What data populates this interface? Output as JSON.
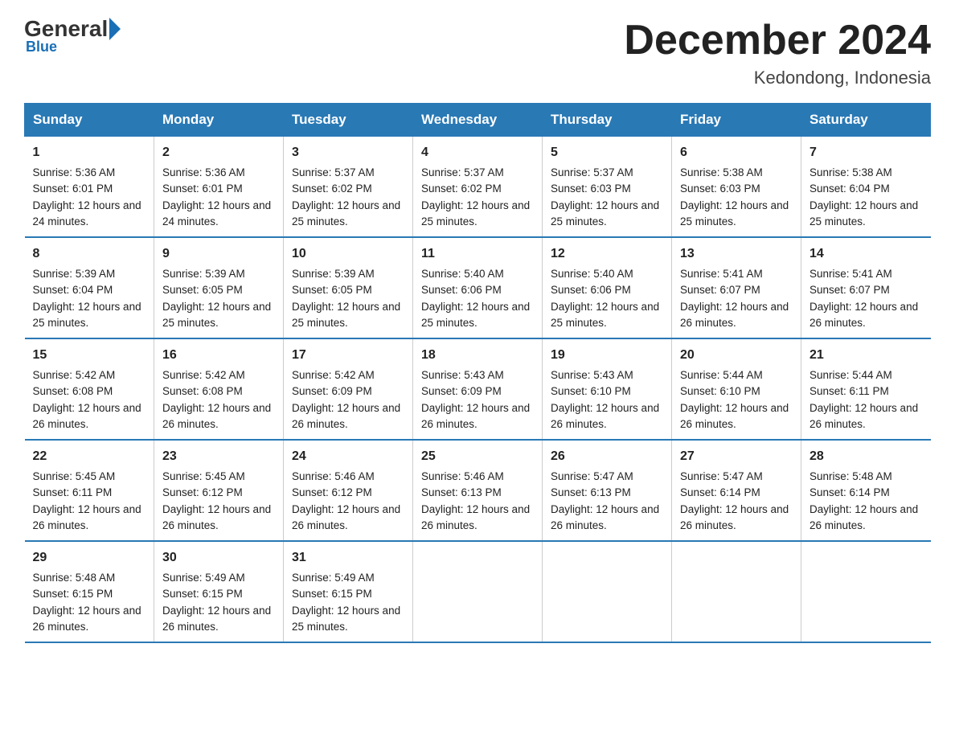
{
  "logo": {
    "general": "General",
    "blue": "Blue",
    "subtitle": "Blue"
  },
  "header": {
    "month_title": "December 2024",
    "location": "Kedondong, Indonesia"
  },
  "days_of_week": [
    "Sunday",
    "Monday",
    "Tuesday",
    "Wednesday",
    "Thursday",
    "Friday",
    "Saturday"
  ],
  "weeks": [
    [
      {
        "day": 1,
        "sunrise": "5:36 AM",
        "sunset": "6:01 PM",
        "daylight": "12 hours and 24 minutes."
      },
      {
        "day": 2,
        "sunrise": "5:36 AM",
        "sunset": "6:01 PM",
        "daylight": "12 hours and 24 minutes."
      },
      {
        "day": 3,
        "sunrise": "5:37 AM",
        "sunset": "6:02 PM",
        "daylight": "12 hours and 25 minutes."
      },
      {
        "day": 4,
        "sunrise": "5:37 AM",
        "sunset": "6:02 PM",
        "daylight": "12 hours and 25 minutes."
      },
      {
        "day": 5,
        "sunrise": "5:37 AM",
        "sunset": "6:03 PM",
        "daylight": "12 hours and 25 minutes."
      },
      {
        "day": 6,
        "sunrise": "5:38 AM",
        "sunset": "6:03 PM",
        "daylight": "12 hours and 25 minutes."
      },
      {
        "day": 7,
        "sunrise": "5:38 AM",
        "sunset": "6:04 PM",
        "daylight": "12 hours and 25 minutes."
      }
    ],
    [
      {
        "day": 8,
        "sunrise": "5:39 AM",
        "sunset": "6:04 PM",
        "daylight": "12 hours and 25 minutes."
      },
      {
        "day": 9,
        "sunrise": "5:39 AM",
        "sunset": "6:05 PM",
        "daylight": "12 hours and 25 minutes."
      },
      {
        "day": 10,
        "sunrise": "5:39 AM",
        "sunset": "6:05 PM",
        "daylight": "12 hours and 25 minutes."
      },
      {
        "day": 11,
        "sunrise": "5:40 AM",
        "sunset": "6:06 PM",
        "daylight": "12 hours and 25 minutes."
      },
      {
        "day": 12,
        "sunrise": "5:40 AM",
        "sunset": "6:06 PM",
        "daylight": "12 hours and 25 minutes."
      },
      {
        "day": 13,
        "sunrise": "5:41 AM",
        "sunset": "6:07 PM",
        "daylight": "12 hours and 26 minutes."
      },
      {
        "day": 14,
        "sunrise": "5:41 AM",
        "sunset": "6:07 PM",
        "daylight": "12 hours and 26 minutes."
      }
    ],
    [
      {
        "day": 15,
        "sunrise": "5:42 AM",
        "sunset": "6:08 PM",
        "daylight": "12 hours and 26 minutes."
      },
      {
        "day": 16,
        "sunrise": "5:42 AM",
        "sunset": "6:08 PM",
        "daylight": "12 hours and 26 minutes."
      },
      {
        "day": 17,
        "sunrise": "5:42 AM",
        "sunset": "6:09 PM",
        "daylight": "12 hours and 26 minutes."
      },
      {
        "day": 18,
        "sunrise": "5:43 AM",
        "sunset": "6:09 PM",
        "daylight": "12 hours and 26 minutes."
      },
      {
        "day": 19,
        "sunrise": "5:43 AM",
        "sunset": "6:10 PM",
        "daylight": "12 hours and 26 minutes."
      },
      {
        "day": 20,
        "sunrise": "5:44 AM",
        "sunset": "6:10 PM",
        "daylight": "12 hours and 26 minutes."
      },
      {
        "day": 21,
        "sunrise": "5:44 AM",
        "sunset": "6:11 PM",
        "daylight": "12 hours and 26 minutes."
      }
    ],
    [
      {
        "day": 22,
        "sunrise": "5:45 AM",
        "sunset": "6:11 PM",
        "daylight": "12 hours and 26 minutes."
      },
      {
        "day": 23,
        "sunrise": "5:45 AM",
        "sunset": "6:12 PM",
        "daylight": "12 hours and 26 minutes."
      },
      {
        "day": 24,
        "sunrise": "5:46 AM",
        "sunset": "6:12 PM",
        "daylight": "12 hours and 26 minutes."
      },
      {
        "day": 25,
        "sunrise": "5:46 AM",
        "sunset": "6:13 PM",
        "daylight": "12 hours and 26 minutes."
      },
      {
        "day": 26,
        "sunrise": "5:47 AM",
        "sunset": "6:13 PM",
        "daylight": "12 hours and 26 minutes."
      },
      {
        "day": 27,
        "sunrise": "5:47 AM",
        "sunset": "6:14 PM",
        "daylight": "12 hours and 26 minutes."
      },
      {
        "day": 28,
        "sunrise": "5:48 AM",
        "sunset": "6:14 PM",
        "daylight": "12 hours and 26 minutes."
      }
    ],
    [
      {
        "day": 29,
        "sunrise": "5:48 AM",
        "sunset": "6:15 PM",
        "daylight": "12 hours and 26 minutes."
      },
      {
        "day": 30,
        "sunrise": "5:49 AM",
        "sunset": "6:15 PM",
        "daylight": "12 hours and 26 minutes."
      },
      {
        "day": 31,
        "sunrise": "5:49 AM",
        "sunset": "6:15 PM",
        "daylight": "12 hours and 25 minutes."
      },
      null,
      null,
      null,
      null
    ]
  ]
}
